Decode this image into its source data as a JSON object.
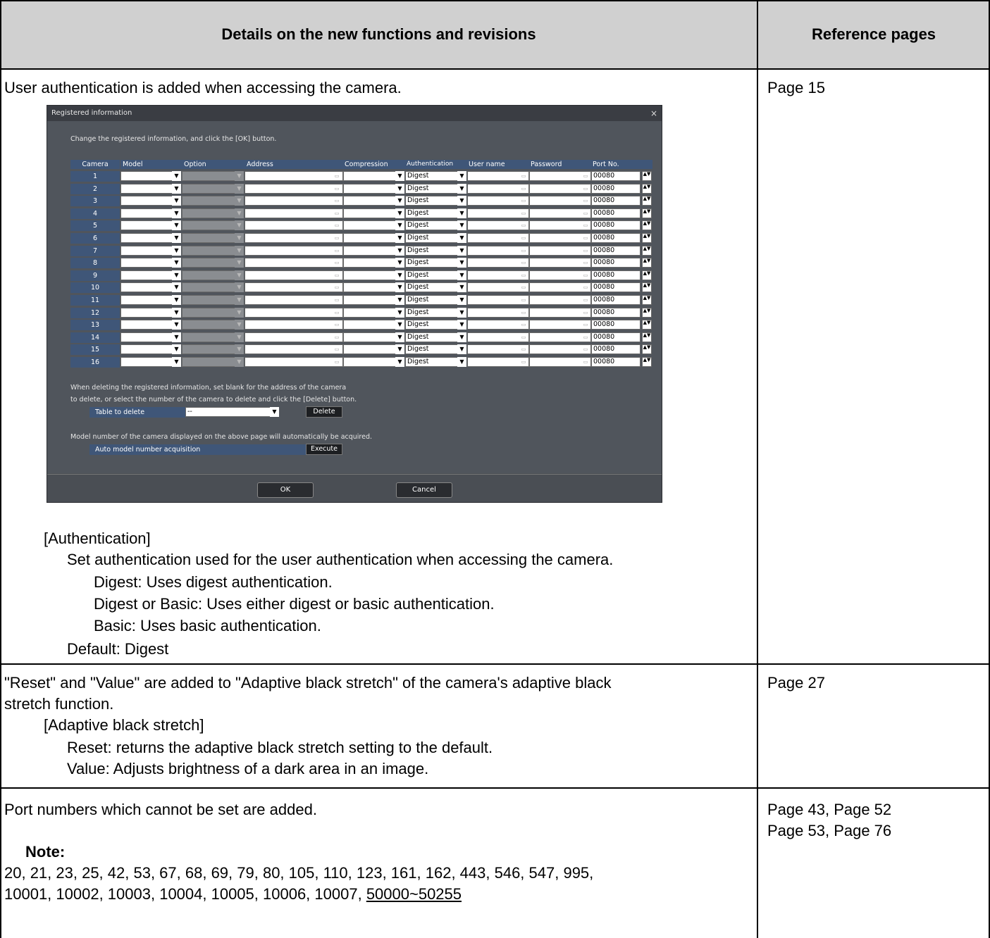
{
  "table": {
    "header_details": "Details on the new functions and revisions",
    "header_reference": "Reference pages"
  },
  "row1": {
    "intro": "User authentication is added when accessing the camera.",
    "ref": "Page 15",
    "auth_heading": "[Authentication]",
    "auth_desc": "Set authentication used for the user authentication when accessing the camera.",
    "opt_digest": "Digest: Uses digest authentication.",
    "opt_digest_basic": "Digest or Basic: Uses either digest or basic authentication.",
    "opt_basic": "Basic: Uses basic authentication.",
    "default": "Default: Digest"
  },
  "dialog": {
    "title": "Registered information",
    "close": "×",
    "instruction": "Change the registered information, and click the [OK] button.",
    "columns": [
      "Camera",
      "Model",
      "Option",
      "Address",
      "Compression",
      "Authentication",
      "User name",
      "Password",
      "Port No."
    ],
    "auth_value": "Digest",
    "port_value": "00080",
    "cameras": [
      "1",
      "2",
      "3",
      "4",
      "5",
      "6",
      "7",
      "8",
      "9",
      "10",
      "11",
      "12",
      "13",
      "14",
      "15",
      "16"
    ],
    "delete_note_1": "When deleting the registered information, set blank for the address of the camera",
    "delete_note_2": "to delete, or select the number of the camera to delete and click the [Delete] button.",
    "table_to_delete": "Table to delete",
    "delete_select": "--",
    "delete_button": "Delete",
    "model_note": "Model number of the camera displayed on the above page will automatically be acquired.",
    "auto_model": "Auto model number acquisition",
    "execute_button": "Execute",
    "ok_button": "OK",
    "cancel_button": "Cancel"
  },
  "row2": {
    "line1": "\"Reset\" and \"Value\" are added to \"Adaptive black stretch\" of the camera's adaptive black",
    "line2": "stretch function.",
    "heading": "[Adaptive black stretch]",
    "reset": "Reset: returns the adaptive black stretch setting to the default.",
    "value": "Value: Adjusts brightness of a dark area in an image.",
    "ref": "Page 27"
  },
  "row3": {
    "intro": "Port numbers which cannot be set are added.",
    "note_label": "Note:",
    "ports_line1": "20, 21, 23, 25, 42, 53, 67, 68, 69, 79, 80, 105, 110, 123, 161, 162, 443, 546, 547, 995,",
    "ports_line2": "10001, 10002, 10003, 10004, 10005, 10006, 10007, ",
    "ports_range": "50000~50255",
    "ref_line1": "Page 43, Page 52",
    "ref_line2": "Page 53, Page 76"
  }
}
